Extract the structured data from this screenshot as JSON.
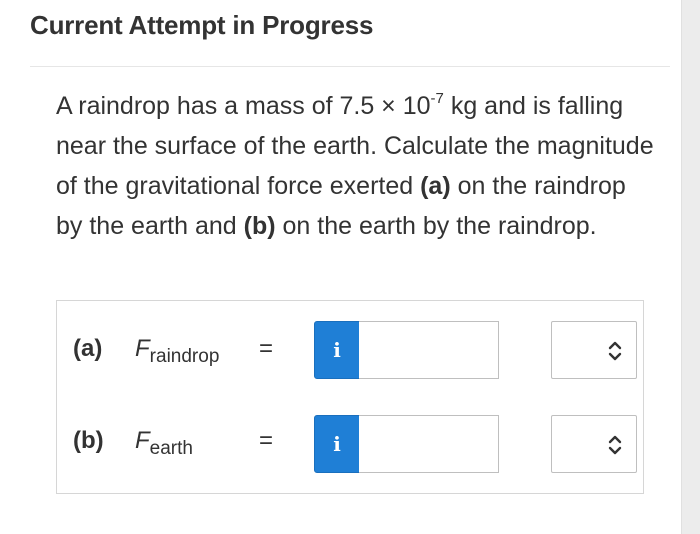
{
  "header": {
    "title": "Current Attempt in Progress"
  },
  "question": {
    "text_1": "A raindrop has a mass of 7.5 × 10",
    "exponent": "-7",
    "text_2": " kg and is falling near the surface of the earth. Calculate the magnitude of the gravitational force exerted ",
    "part_a_label": "(a)",
    "text_3": " on the raindrop by the earth and ",
    "part_b_label": "(b)",
    "text_4": " on the earth by the raindrop."
  },
  "answers": [
    {
      "label": "(a)",
      "variable": "F",
      "subscript": "raindrop",
      "equals": "=",
      "info_icon": "i",
      "value": "",
      "unit": ""
    },
    {
      "label": "(b)",
      "variable": "F",
      "subscript": "earth",
      "equals": "=",
      "info_icon": "i",
      "value": "",
      "unit": ""
    }
  ],
  "colors": {
    "info_button": "#1f7fd6",
    "text": "#333333",
    "border": "#bfbfbf"
  }
}
